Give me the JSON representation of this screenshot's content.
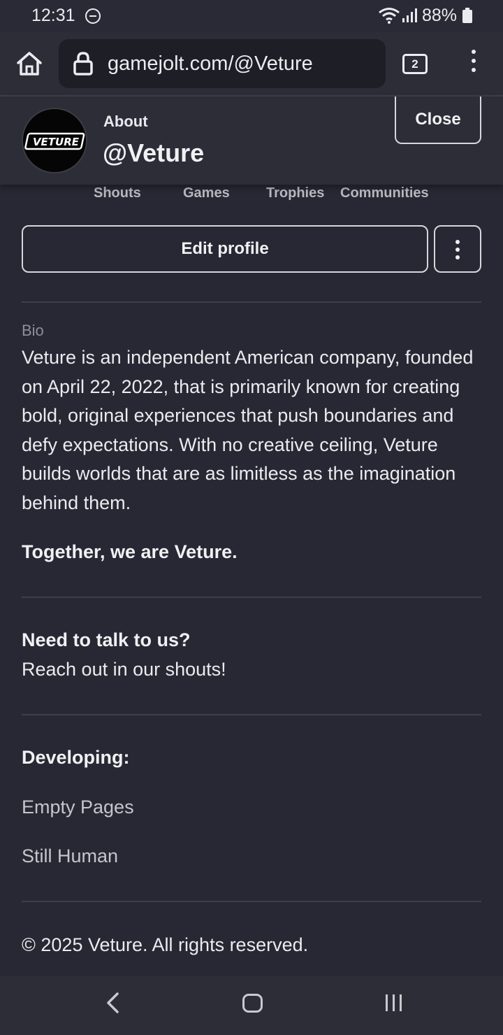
{
  "status_bar": {
    "time": "12:31",
    "battery": "88%"
  },
  "browser": {
    "url": "gamejolt.com/@Veture",
    "tab_count": "2"
  },
  "profile_header": {
    "about_label": "About",
    "handle": "@Veture",
    "close_label": "Close",
    "avatar_logo_text": "VETURE"
  },
  "tabs": [
    {
      "label": "Shouts"
    },
    {
      "label": "Games"
    },
    {
      "label": "Trophies"
    },
    {
      "label": "Communities"
    }
  ],
  "actions": {
    "edit_label": "Edit profile"
  },
  "bio": {
    "label": "Bio",
    "text": "Veture is an independent American company, founded on April 22, 2022, that is primarily known for creating bold, original experiences that push boundaries and defy expectations. With no creative ceiling, Veture builds worlds that are as limitless as the imagination behind them.",
    "tagline": "Together, we are Veture.",
    "contact_heading": "Need to talk to us?",
    "contact_text": "Reach out in our shouts!",
    "developing_heading": "Developing:",
    "developing_items": [
      "Empty Pages",
      "Still Human"
    ],
    "copyright": "© 2025 Veture. All rights reserved."
  },
  "colors": {
    "background": "#272833",
    "header": "#2c2d37",
    "text": "#ebebef",
    "muted": "#8e8f98"
  }
}
